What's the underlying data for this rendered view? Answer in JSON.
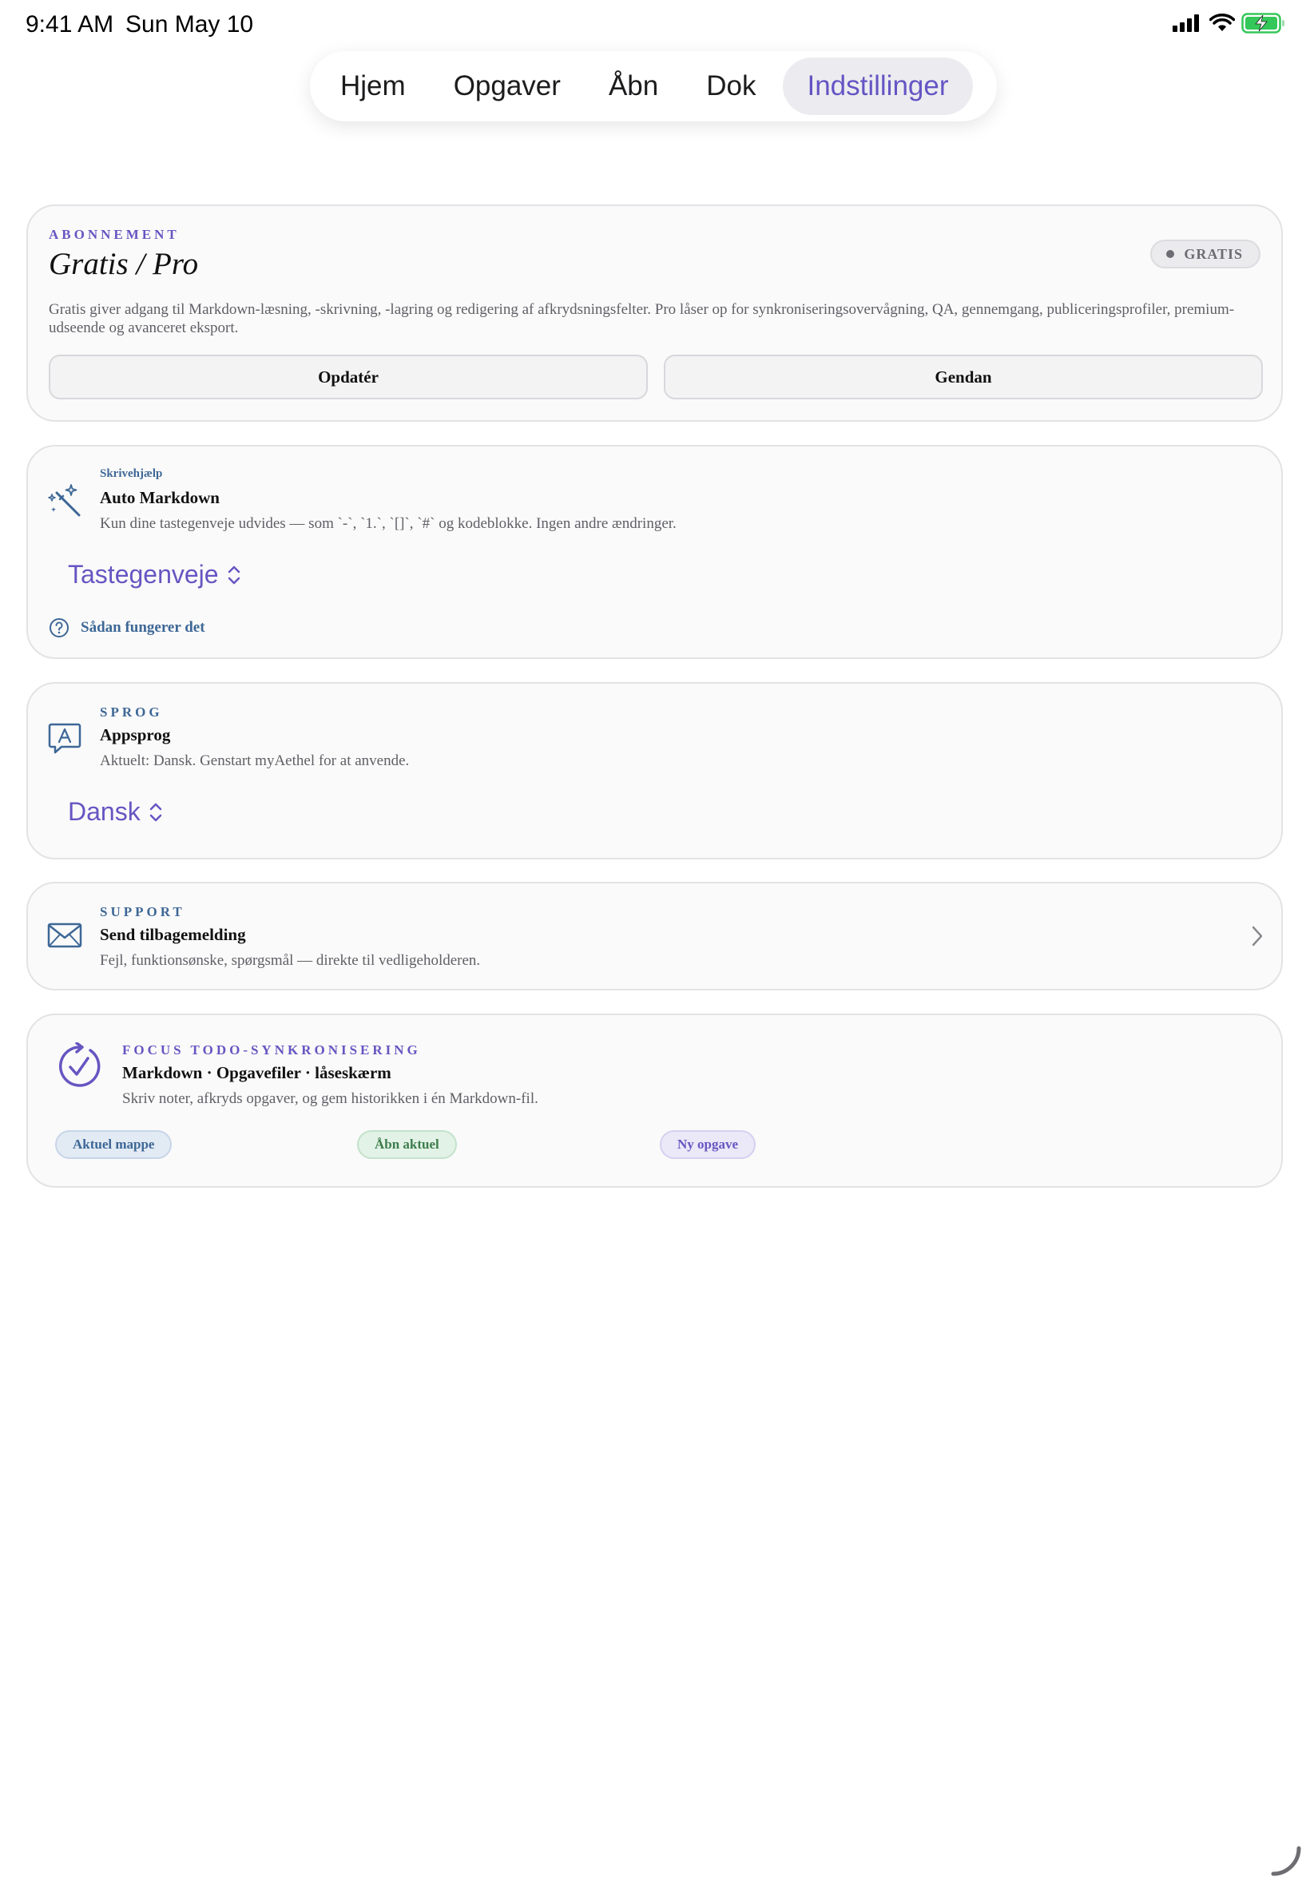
{
  "status_bar": {
    "time": "9:41 AM",
    "date": "Sun May 10"
  },
  "tabs": [
    {
      "label": "Hjem",
      "active": false
    },
    {
      "label": "Opgaver",
      "active": false
    },
    {
      "label": "Åbn",
      "active": false
    },
    {
      "label": "Dok",
      "active": false
    },
    {
      "label": "Indstillinger",
      "active": true
    }
  ],
  "subscription": {
    "eyebrow": "ABONNEMENT",
    "title": "Gratis / Pro",
    "badge": "GRATIS",
    "description": "Gratis giver adgang til Markdown-læsning, -skrivning, -lagring og redigering af afkrydsningsfelter. Pro låser op for synkroniseringsovervågning, QA, gennemgang, publiceringsprofiler, premium-udseende og avanceret eksport.",
    "upgrade_label": "Opdatér",
    "restore_label": "Gendan"
  },
  "writing_help": {
    "eyebrow": "Skrivehjælp",
    "title": "Auto Markdown",
    "description": "Kun dine tastegenveje udvides — som `-`, `1.`, `[]`, `#` og kodeblokke. Ingen andre ændringer.",
    "picker_value": "Tastegenveje",
    "help_link": "Sådan fungerer det",
    "icon": "magic-wand-icon"
  },
  "language": {
    "eyebrow": "SPROG",
    "title": "Appsprog",
    "description": "Aktuelt: Dansk. Genstart myAethel for at anvende.",
    "picker_value": "Dansk",
    "icon": "language-bubble-icon"
  },
  "support": {
    "eyebrow": "SUPPORT",
    "title": "Send tilbagemelding",
    "description": "Fejl, funktionsønske, spørgsmål — direkte til vedligeholderen.",
    "icon": "envelope-icon"
  },
  "focus_sync": {
    "eyebrow": "FOCUS TODO-SYNKRONISERING",
    "title": "Markdown · Opgavefiler · låseskærm",
    "description": "Skriv noter, afkryds opgaver, og gem historikken i én Markdown-fil.",
    "chips": [
      "Aktuel mappe",
      "Åbn aktuel",
      "Ny opgave"
    ],
    "icon": "sync-check-icon"
  },
  "colors": {
    "accent": "#6656c2",
    "blue": "#3d6796",
    "green": "#3d7d4c",
    "battery": "#34c759"
  }
}
